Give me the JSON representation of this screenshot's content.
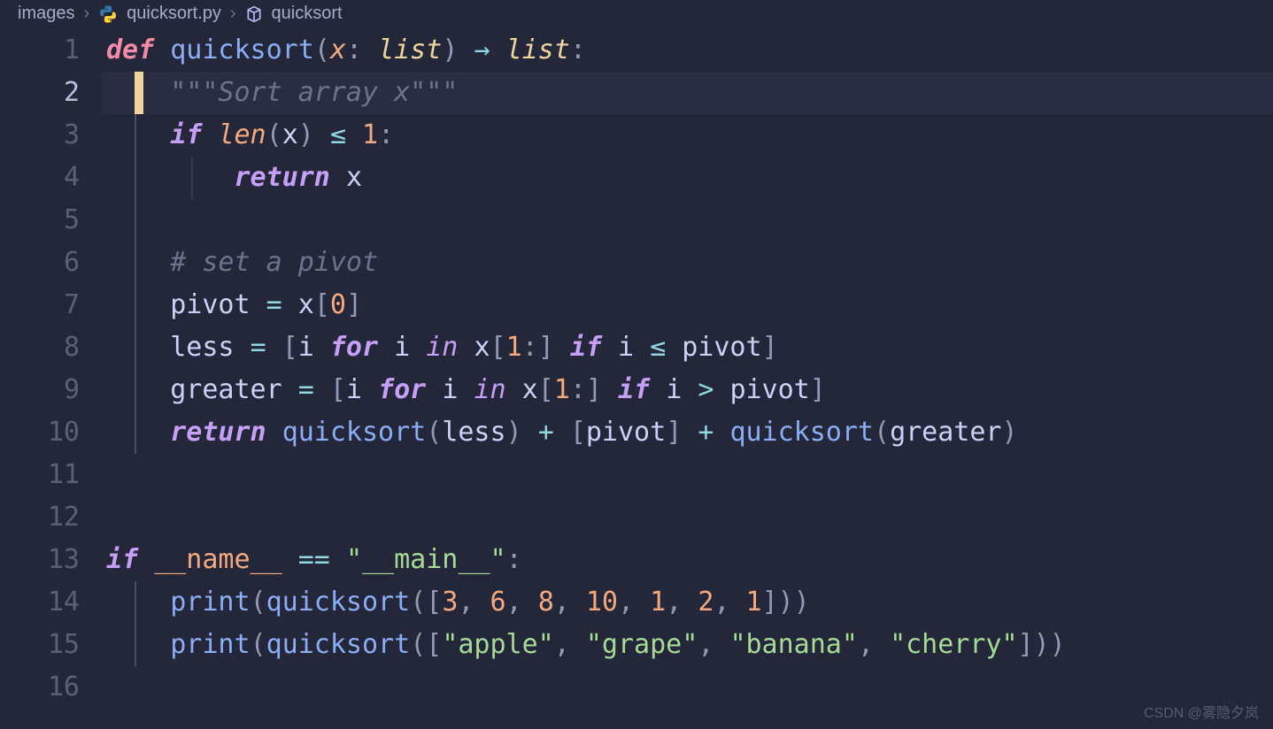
{
  "breadcrumbs": {
    "folder": "images",
    "file": "quicksort.py",
    "symbol": "quicksort"
  },
  "editor": {
    "current_line": 2,
    "line_count": 16,
    "lines": [
      "1",
      "2",
      "3",
      "4",
      "5",
      "6",
      "7",
      "8",
      "9",
      "10",
      "11",
      "12",
      "13",
      "14",
      "15",
      "16"
    ]
  },
  "code_tokens": {
    "l1": {
      "def": "def",
      "fn": "quicksort",
      "param": "x",
      "type1": "list",
      "arrow": "→",
      "type2": "list"
    },
    "l2": {
      "doc": "\"\"\"Sort array x\"\"\""
    },
    "l3": {
      "if": "if",
      "len": "len",
      "x": "x",
      "le": "≤",
      "one": "1"
    },
    "l4": {
      "ret": "return",
      "x": "x"
    },
    "l6": {
      "comment": "# set a pivot"
    },
    "l7": {
      "pivot": "pivot",
      "eq": "=",
      "x": "x",
      "zero": "0"
    },
    "l8": {
      "less": "less",
      "eq": "=",
      "i1": "i",
      "for": "for",
      "i2": "i",
      "in": "in",
      "x": "x",
      "one": "1",
      "if": "if",
      "i3": "i",
      "le": "≤",
      "pivot": "pivot"
    },
    "l9": {
      "greater": "greater",
      "eq": "=",
      "i1": "i",
      "for": "for",
      "i2": "i",
      "in": "in",
      "x": "x",
      "one": "1",
      "if": "if",
      "i3": "i",
      "gt": ">",
      "pivot": "pivot"
    },
    "l10": {
      "ret": "return",
      "fn1": "quicksort",
      "less": "less",
      "plus1": "+",
      "pivot": "pivot",
      "plus2": "+",
      "fn2": "quicksort",
      "greater": "greater"
    },
    "l13": {
      "if": "if",
      "name": "__name__",
      "eq": "==",
      "main": "\"__main__\""
    },
    "l14": {
      "print": "print",
      "fn": "quicksort",
      "n1": "3",
      "n2": "6",
      "n3": "8",
      "n4": "10",
      "n5": "1",
      "n6": "2",
      "n7": "1"
    },
    "l15": {
      "print": "print",
      "fn": "quicksort",
      "s1": "\"apple\"",
      "s2": "\"grape\"",
      "s3": "\"banana\"",
      "s4": "\"cherry\""
    }
  },
  "watermark": "CSDN @雾隐夕岚"
}
